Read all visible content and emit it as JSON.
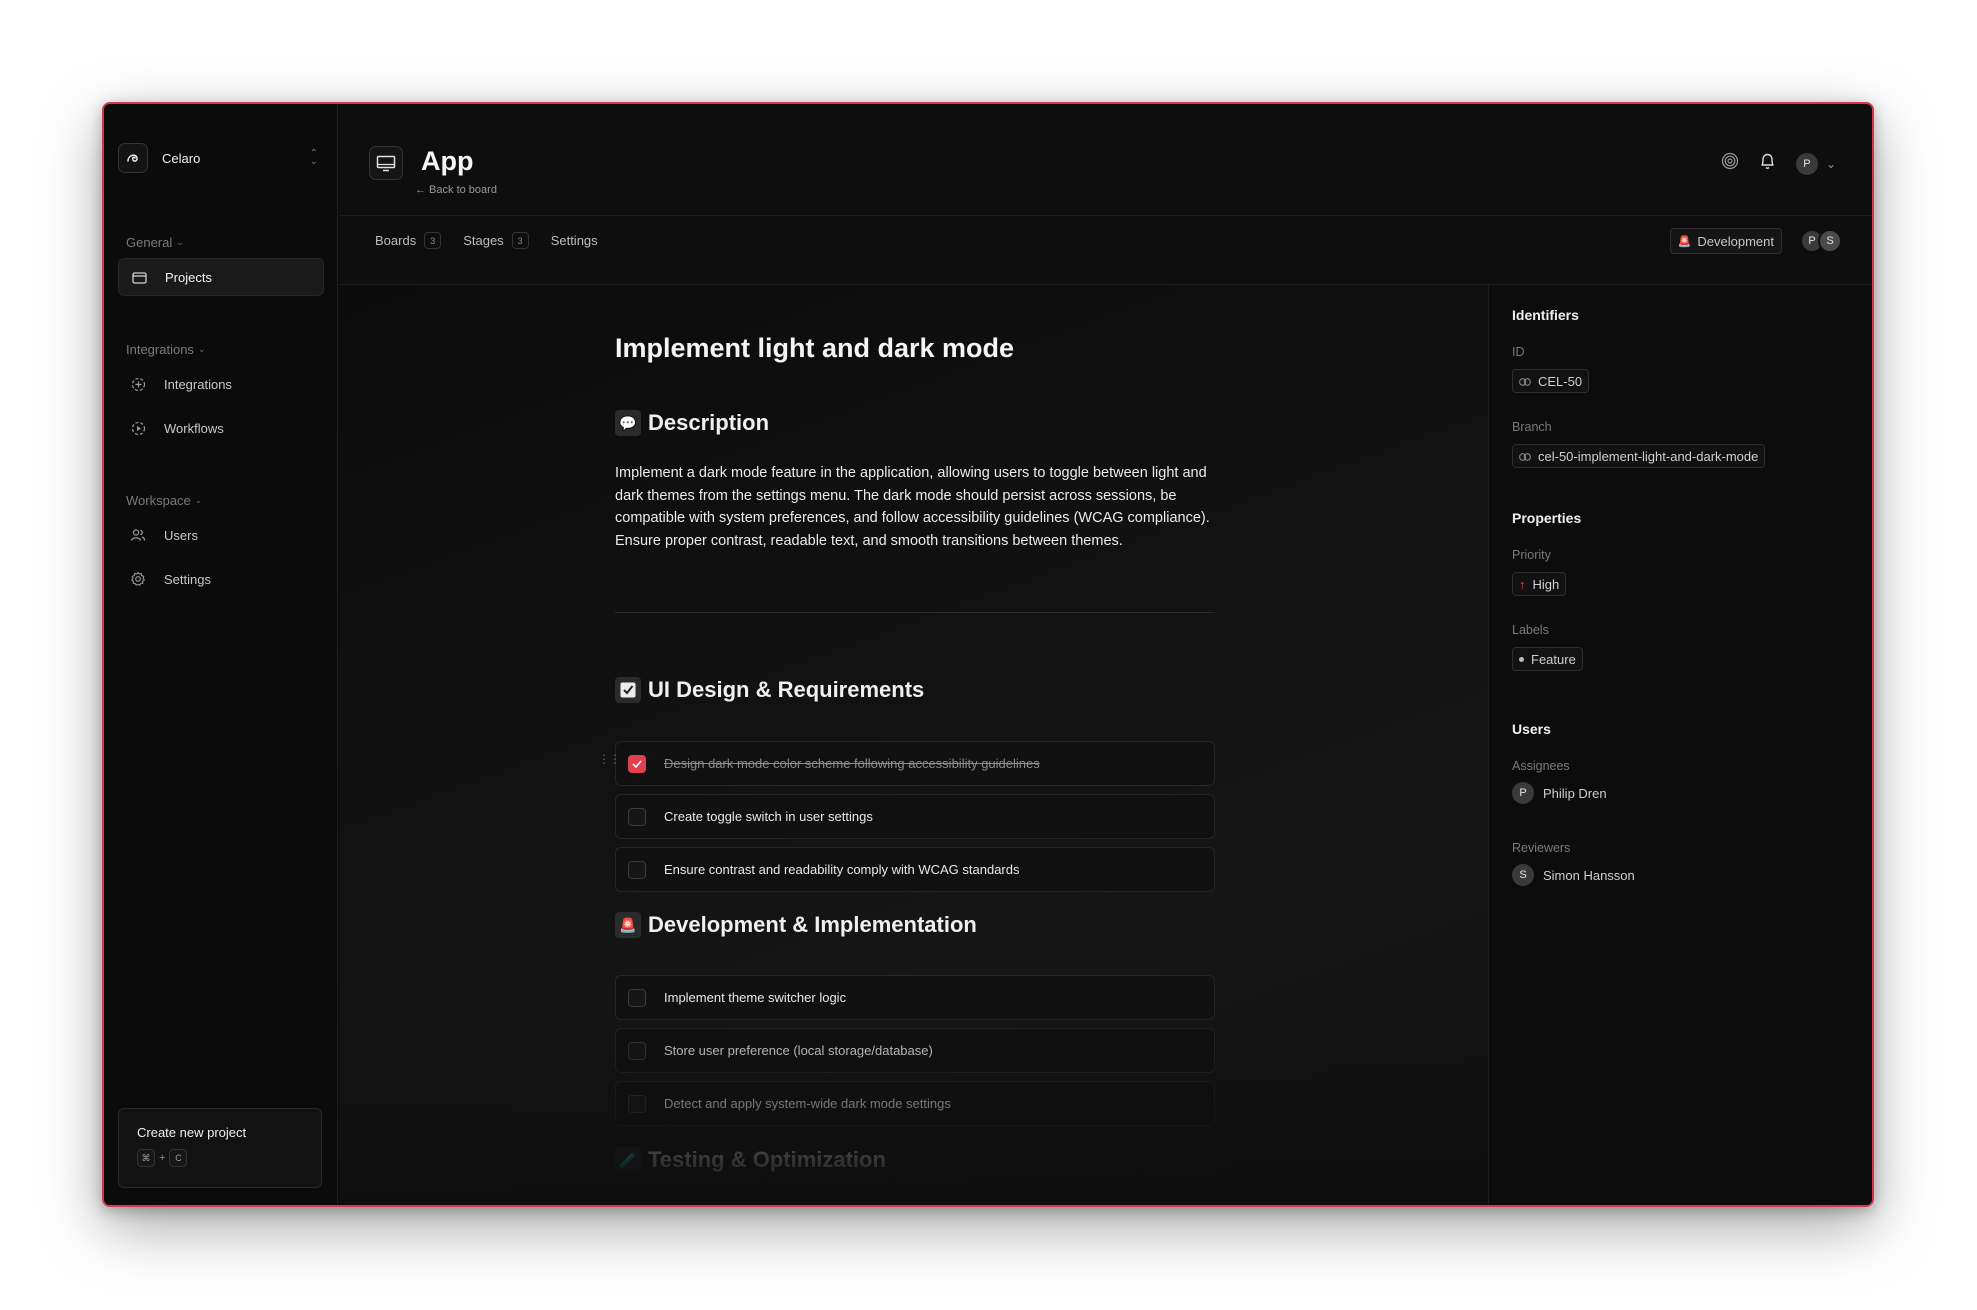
{
  "workspace": {
    "name": "Celaro"
  },
  "sidebar": {
    "groups": [
      {
        "label": "General",
        "items": [
          {
            "label": "Projects",
            "icon": "folder-icon",
            "active": true
          }
        ]
      },
      {
        "label": "Integrations",
        "items": [
          {
            "label": "Integrations",
            "icon": "plug-icon"
          },
          {
            "label": "Workflows",
            "icon": "workflow-icon"
          }
        ]
      },
      {
        "label": "Workspace",
        "items": [
          {
            "label": "Users",
            "icon": "users-icon"
          },
          {
            "label": "Settings",
            "icon": "gear-icon"
          }
        ]
      }
    ],
    "create_card": {
      "title": "Create new project",
      "shortcut": [
        "⌘",
        "+",
        "C"
      ]
    }
  },
  "header": {
    "title": "App",
    "back_label": "← Back to board",
    "user_initial": "P"
  },
  "tabs": [
    {
      "label": "Boards",
      "count": "3"
    },
    {
      "label": "Stages",
      "count": "3"
    },
    {
      "label": "Settings"
    }
  ],
  "stage_badge": {
    "label": "Development",
    "emoji": "🚨"
  },
  "members": [
    "P",
    "S"
  ],
  "doc": {
    "title": "Implement light and dark mode",
    "description_heading": "Description",
    "description_emoji": "💬",
    "description": "Implement a dark mode feature in the application, allowing users to toggle between light and dark themes from the settings menu. The dark mode should persist across sessions, be compatible with system preferences, and follow accessibility guidelines (WCAG compliance). Ensure proper contrast, readable text, and smooth transitions between themes.",
    "sections": [
      {
        "heading": "UI Design & Requirements",
        "emoji": "☑️",
        "tasks": [
          {
            "text": "Design dark mode color scheme following accessibility guidelines",
            "done": true
          },
          {
            "text": "Create toggle switch in user settings",
            "done": false
          },
          {
            "text": "Ensure contrast and readability comply with WCAG standards",
            "done": false
          }
        ]
      },
      {
        "heading": "Development & Implementation",
        "emoji": "🚨",
        "tasks": [
          {
            "text": "Implement theme switcher logic",
            "done": false
          },
          {
            "text": "Store user preference (local storage/database)",
            "done": false
          },
          {
            "text": "Detect and apply system-wide dark mode settings",
            "done": false
          }
        ]
      },
      {
        "heading": "Testing & Optimization",
        "emoji": "🧪",
        "tasks": []
      }
    ]
  },
  "panel": {
    "identifiers_heading": "Identifiers",
    "id_label": "ID",
    "id_value": "CEL-50",
    "branch_label": "Branch",
    "branch_value": "cel-50-implement-light-and-dark-mode",
    "properties_heading": "Properties",
    "priority_label": "Priority",
    "priority_value": "High",
    "labels_label": "Labels",
    "label_value": "Feature",
    "users_heading": "Users",
    "assignees_label": "Assignees",
    "assignee": {
      "initial": "P",
      "name": "Philip Dren"
    },
    "reviewers_label": "Reviewers",
    "reviewer": {
      "initial": "S",
      "name": "Simon Hansson"
    }
  },
  "colors": {
    "accent": "#e2404f",
    "frame_border": "#d3374a"
  }
}
